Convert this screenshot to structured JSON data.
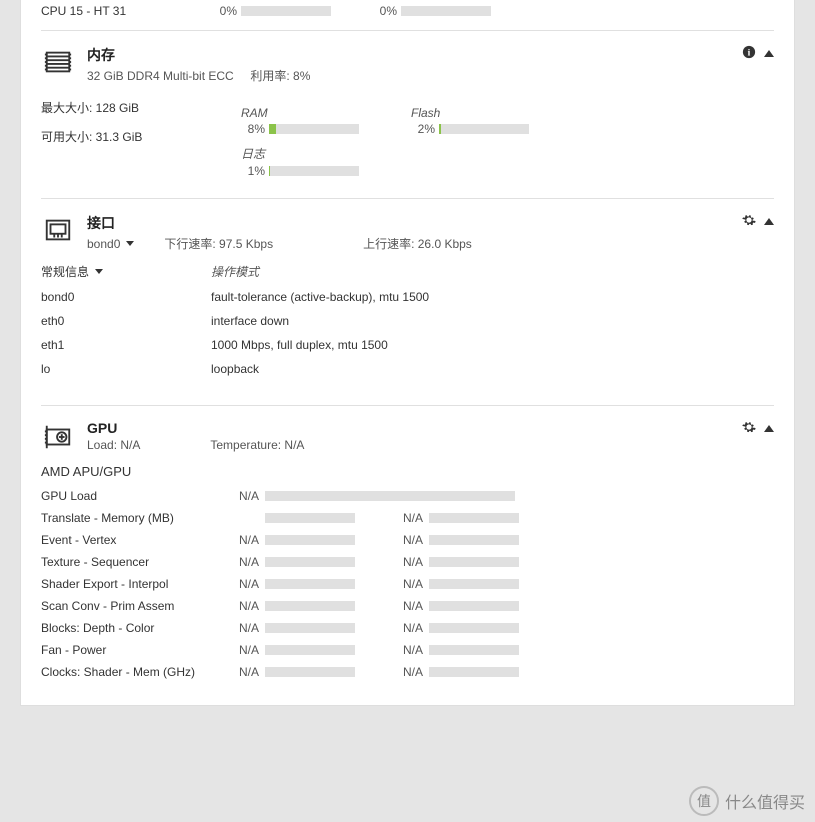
{
  "cpu_tail": {
    "label": "CPU 15 - HT 31",
    "left_pct": "0%",
    "right_pct": "0%"
  },
  "memory": {
    "title": "内存",
    "spec": "32 GiB DDR4 Multi-bit ECC",
    "util_label": "利用率: 8%",
    "max_label": "最大大小: 128 GiB",
    "avail_label": "可用大小: 31.3 GiB",
    "bars": {
      "ram": {
        "label": "RAM",
        "pct": "8%",
        "fill": 8
      },
      "flash": {
        "label": "Flash",
        "pct": "2%",
        "fill": 2
      },
      "log": {
        "label": "日志",
        "pct": "1%",
        "fill": 1
      }
    }
  },
  "iface": {
    "title": "接口",
    "selected": "bond0",
    "down_label": "下行速率: 97.5 Kbps",
    "up_label": "上行速率: 26.0 Kbps",
    "col1_header": "常规信息",
    "col2_header": "操作模式",
    "rows": [
      {
        "name": "bond0",
        "mode": "fault-tolerance (active-backup), mtu 1500"
      },
      {
        "name": "eth0",
        "mode": "interface down"
      },
      {
        "name": "eth1",
        "mode": "1000 Mbps, full duplex, mtu 1500"
      },
      {
        "name": "lo",
        "mode": "loopback"
      }
    ]
  },
  "gpu": {
    "title": "GPU",
    "load_label": "Load: N/A",
    "temp_label": "Temperature: N/A",
    "device": "AMD APU/GPU",
    "rows": [
      {
        "label": "GPU Load",
        "single": true,
        "v1": "N/A"
      },
      {
        "label": "Translate - Memory (MB)",
        "v1": "",
        "v2": "N/A"
      },
      {
        "label": "Event - Vertex",
        "v1": "N/A",
        "v2": "N/A"
      },
      {
        "label": "Texture - Sequencer",
        "v1": "N/A",
        "v2": "N/A"
      },
      {
        "label": "Shader Export - Interpol",
        "v1": "N/A",
        "v2": "N/A"
      },
      {
        "label": "Scan Conv - Prim Assem",
        "v1": "N/A",
        "v2": "N/A"
      },
      {
        "label": "Blocks: Depth - Color",
        "v1": "N/A",
        "v2": "N/A"
      },
      {
        "label": "Fan - Power",
        "v1": "N/A",
        "v2": "N/A"
      },
      {
        "label": "Clocks: Shader - Mem (GHz)",
        "v1": "N/A",
        "v2": "N/A"
      }
    ]
  },
  "watermark": {
    "icon": "值",
    "text": "什么值得买"
  }
}
